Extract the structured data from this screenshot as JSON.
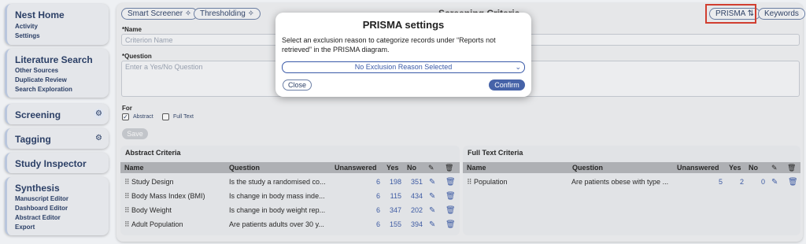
{
  "sidebar": {
    "nest_home": {
      "title": "Nest Home",
      "items": [
        "Activity",
        "Settings"
      ]
    },
    "literature_search": {
      "title": "Literature Search",
      "items": [
        "Other Sources",
        "Duplicate Review",
        "Search Exploration"
      ]
    },
    "screening": {
      "title": "Screening"
    },
    "tagging": {
      "title": "Tagging"
    },
    "study_inspector": {
      "title": "Study Inspector"
    },
    "synthesis": {
      "title": "Synthesis",
      "items": [
        "Manuscript Editor",
        "Dashboard Editor",
        "Abstract Editor",
        "Export"
      ]
    }
  },
  "toolbar": {
    "smart_screener": "Smart Screener",
    "thresholding": "Thresholding",
    "page_title": "Screening Criteria",
    "prisma": "PRISMA",
    "keywords": "Keywords"
  },
  "form": {
    "name_label": "*Name",
    "name_placeholder": "Criterion Name",
    "question_label": "*Question",
    "question_placeholder": "Enter a Yes/No Question",
    "for_label": "For",
    "abstract_label": "Abstract",
    "fulltext_label": "Full Text",
    "save_label": "Save"
  },
  "abstract_criteria": {
    "title": "Abstract Criteria",
    "headers": [
      "Name",
      "Question",
      "Unanswered",
      "Yes",
      "No"
    ],
    "rows": [
      {
        "name": "Study Design",
        "question": "Is the study a randomised co...",
        "unanswered": "6",
        "yes": "198",
        "no": "351"
      },
      {
        "name": "Body Mass Index (BMI)",
        "question": "Is change in body mass inde...",
        "unanswered": "6",
        "yes": "115",
        "no": "434"
      },
      {
        "name": "Body Weight",
        "question": "Is change in body weight rep...",
        "unanswered": "6",
        "yes": "347",
        "no": "202"
      },
      {
        "name": "Adult Population",
        "question": "Are patients adults over 30 y...",
        "unanswered": "6",
        "yes": "155",
        "no": "394"
      }
    ]
  },
  "fulltext_criteria": {
    "title": "Full Text Criteria",
    "headers": [
      "Name",
      "Question",
      "Unanswered",
      "Yes",
      "No"
    ],
    "rows": [
      {
        "name": "Population",
        "question": "Are patients obese with type ...",
        "unanswered": "5",
        "yes": "2",
        "no": "0"
      }
    ]
  },
  "modal": {
    "title": "PRISMA settings",
    "description": "Select an exclusion reason to categorize records under “Reports not retrieved” in the PRISMA diagram.",
    "select_value": "No Exclusion Reason Selected",
    "close_label": "Close",
    "confirm_label": "Confirm"
  },
  "colors": {
    "accent": "#3a5aa8",
    "highlight": "#d93a2b"
  }
}
